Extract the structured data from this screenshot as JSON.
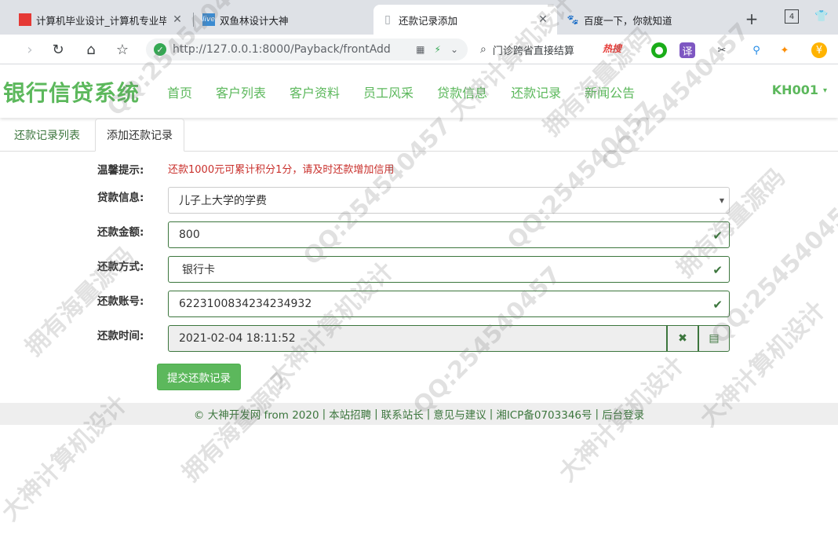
{
  "browser": {
    "tabs": [
      {
        "title": "计算机毕业设计_计算机专业毕业",
        "favicon_color": "#e53935",
        "favicon": "◼"
      },
      {
        "title": "双鱼林设计大神",
        "favicon_color": "#3b8bd1",
        "favicon": "live"
      },
      {
        "title": "还款记录添加",
        "favicon_color": "#9aa0a6",
        "favicon": "▯",
        "active": true
      },
      {
        "title": "百度一下，你就知道",
        "favicon_color": "#2932e1",
        "favicon": "🐾"
      }
    ],
    "tab_close": "✕",
    "new_tab": "+",
    "strip_extra": "4",
    "url": "http://127.0.0.1:8000/Payback/frontAdd",
    "search_hint": "门诊跨省直接结算",
    "hot_label": "热搜"
  },
  "navbar": {
    "brand": "银行信贷系统",
    "menu": [
      "首页",
      "客户列表",
      "客户资料",
      "员工风采",
      "贷款信息",
      "还款记录",
      "新闻公告"
    ],
    "user": "KH001"
  },
  "subtabs": {
    "list": "还款记录列表",
    "add": "添加还款记录"
  },
  "form": {
    "tip_label": "温馨提示:",
    "tip_text": "还款1000元可累计积分1分，请及时还款增加信用",
    "loan_label": "贷款信息:",
    "loan_value": "儿子上大学的学费",
    "amount_label": "还款金额:",
    "amount_value": "800",
    "method_label": "还款方式:",
    "method_value": "银行卡",
    "account_label": "还款账号:",
    "account_value": "6223100834234234932",
    "time_label": "还款时间:",
    "time_value": "2021-02-04 18:11:52",
    "submit_label": "提交还款记录"
  },
  "footer": {
    "copyright": "© 大神开发网 from 2020",
    "links": [
      "本站招聘",
      "联系站长",
      "意见与建议",
      "湘ICP备0703346号",
      "后台登录"
    ],
    "separator": "|"
  },
  "watermarks": [
    "大神计算机设计",
    "QQ:254540457",
    "拥有海量源码"
  ],
  "colors": {
    "brand_green": "#5cb85c",
    "success_green": "#3c763d",
    "tip_red": "#c9302c"
  }
}
